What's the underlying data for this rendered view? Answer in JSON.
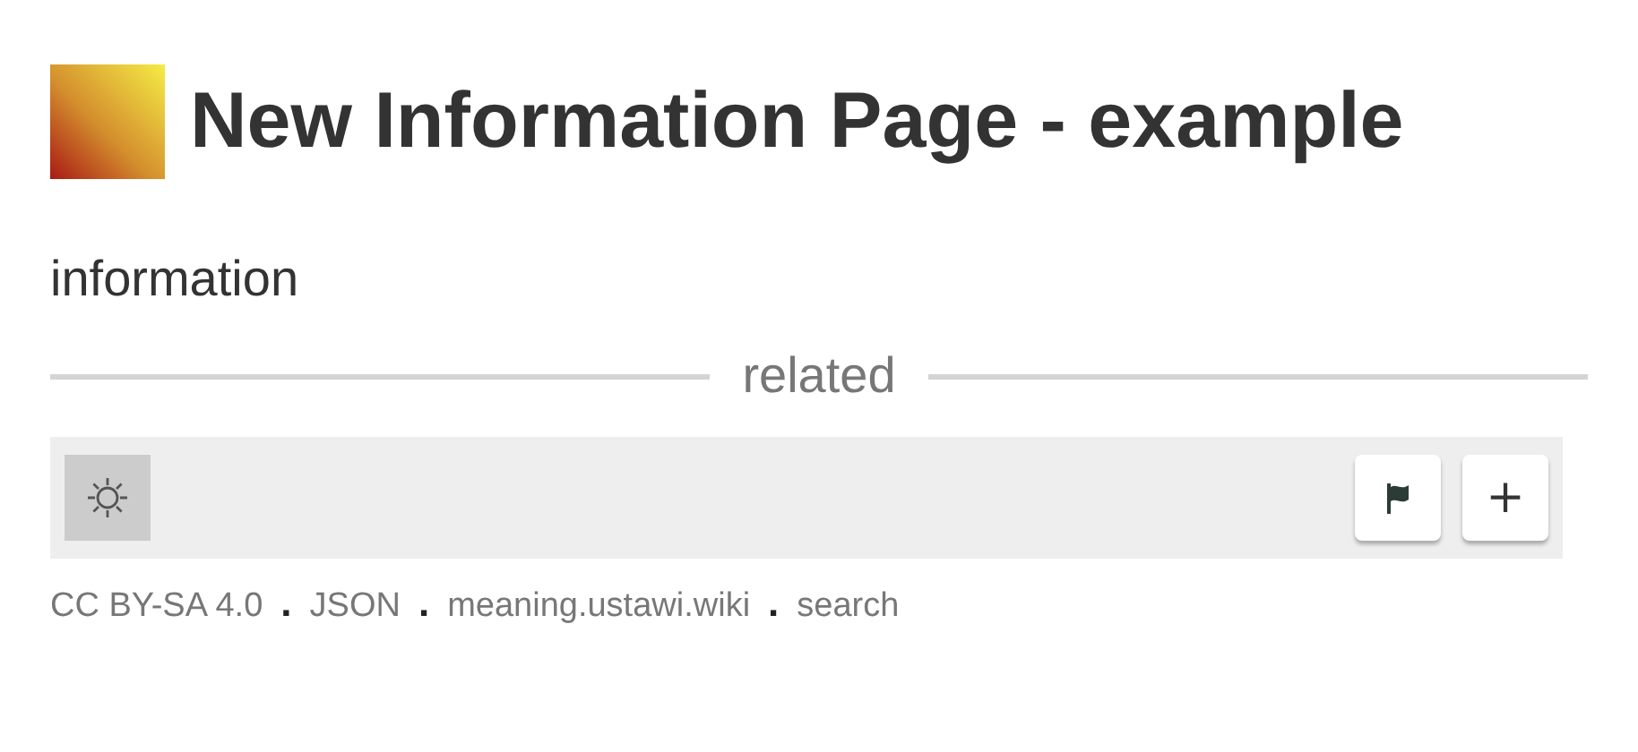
{
  "page": {
    "title": "New Information Page - example",
    "body": "information"
  },
  "related": {
    "heading": "related"
  },
  "toolbar": {
    "add_button": "+"
  },
  "footer": [
    {
      "kind": "link",
      "text": "CC BY-SA 4.0"
    },
    {
      "kind": "separator",
      "text": "."
    },
    {
      "kind": "link",
      "text": "JSON"
    },
    {
      "kind": "separator",
      "text": "."
    },
    {
      "kind": "link",
      "text": "meaning.ustawi.wiki"
    },
    {
      "kind": "separator",
      "text": "."
    },
    {
      "kind": "link",
      "text": "search"
    }
  ]
}
